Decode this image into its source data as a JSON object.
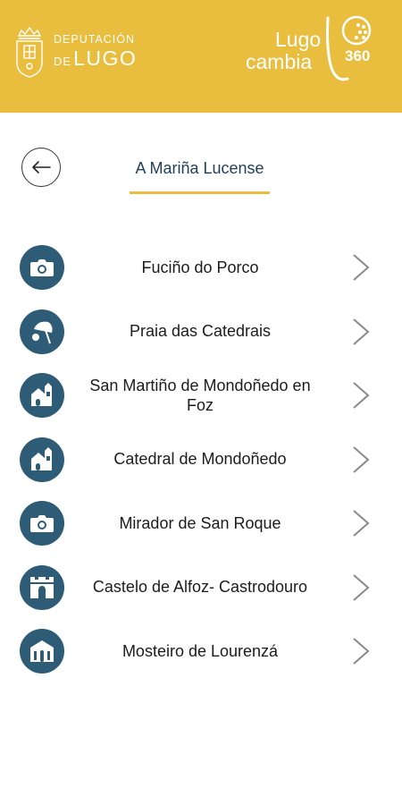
{
  "header": {
    "dep_logo": {
      "line1": "DEPUTACIÓN",
      "de": "DE",
      "lugo": "LUGO"
    },
    "lc_logo": {
      "lugo": "Lugo",
      "cambia": "cambia",
      "num": "360"
    },
    "background_color": "#e9bd3e"
  },
  "page": {
    "title": "A Mariña Lucense",
    "back_icon": "arrow-left-icon"
  },
  "items": [
    {
      "label": "Fuciño do Porco",
      "icon": "camera-icon"
    },
    {
      "label": "Praia das Catedrais",
      "icon": "beach-umbrella-icon"
    },
    {
      "label": "San Martiño de Mondoñedo en Foz",
      "icon": "church-icon"
    },
    {
      "label": "Catedral de Mondoñedo",
      "icon": "church-icon"
    },
    {
      "label": "Mirador de San Roque",
      "icon": "camera-icon"
    },
    {
      "label": "Castelo de Alfoz- Castrodouro",
      "icon": "castle-icon"
    },
    {
      "label": "Mosteiro de Lourenzá",
      "icon": "monastery-icon"
    }
  ],
  "colors": {
    "accent": "#e9bd3e",
    "icon_bg": "#2e5c77",
    "title": "#1f3f5a"
  }
}
